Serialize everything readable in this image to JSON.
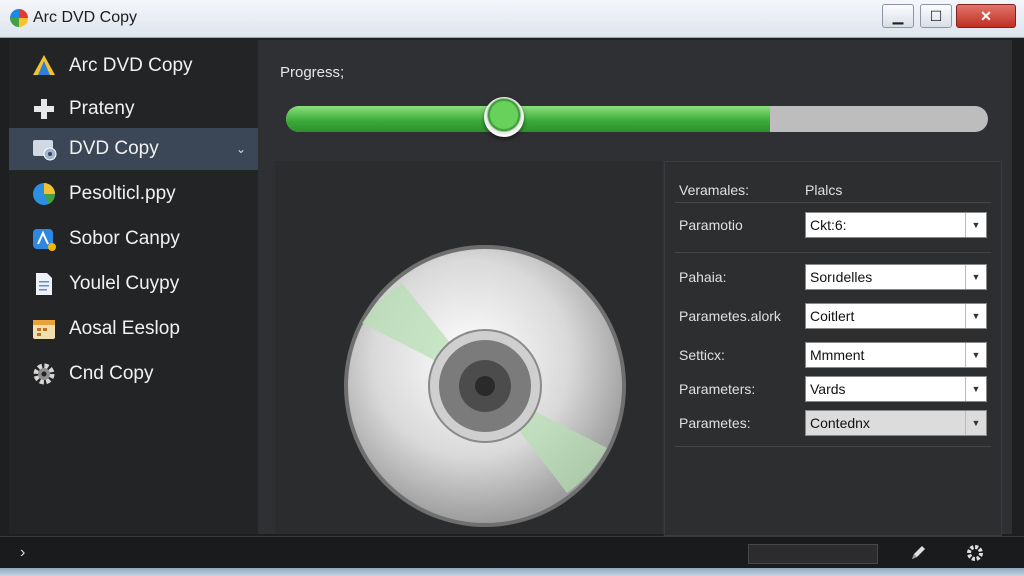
{
  "window": {
    "title": "Arc DVD Copy",
    "controls": {
      "minimize": "▁",
      "maximize": "☐",
      "close": "✕"
    }
  },
  "sidebar": {
    "items": [
      {
        "label": "Arc DVD Copy",
        "icon": "arc-logo-icon"
      },
      {
        "label": "Prateny",
        "icon": "plus-icon"
      },
      {
        "label": "DVD Copy",
        "icon": "dvd-copy-icon",
        "active": true,
        "chevron": "⌄"
      },
      {
        "label": "Pesolticl.ppy",
        "icon": "pie-chart-icon"
      },
      {
        "label": "Sobor Canpy",
        "icon": "app-store-icon"
      },
      {
        "label": "Youlel Cuypy",
        "icon": "document-icon"
      },
      {
        "label": "Aosal Eeslop",
        "icon": "calendar-icon"
      },
      {
        "label": "Cnd Copy",
        "icon": "gear-icon"
      }
    ]
  },
  "main": {
    "progress": {
      "label": "Progress;",
      "fill_fraction": 0.69,
      "thumb_fraction": 0.31
    },
    "params": {
      "header_left": "Veramales:",
      "header_right": "Plalcs",
      "rows": [
        {
          "label": "Paramotio",
          "value": "Ckt:6:"
        },
        {
          "label": "Pahaia:",
          "value": "Sorıdelles"
        },
        {
          "label": "Parametes.alork",
          "value": "Coitlert"
        },
        {
          "label": "Setticx:",
          "value": "Mmment"
        },
        {
          "label": "Parameters:",
          "value": "Vards"
        },
        {
          "label": "Parametes:",
          "value": "Contednx"
        }
      ]
    }
  },
  "statusbar": {
    "expand": "›"
  },
  "colors": {
    "accent_green": "#39a838",
    "active_item": "#3b4656",
    "close_red": "#c9463a"
  }
}
